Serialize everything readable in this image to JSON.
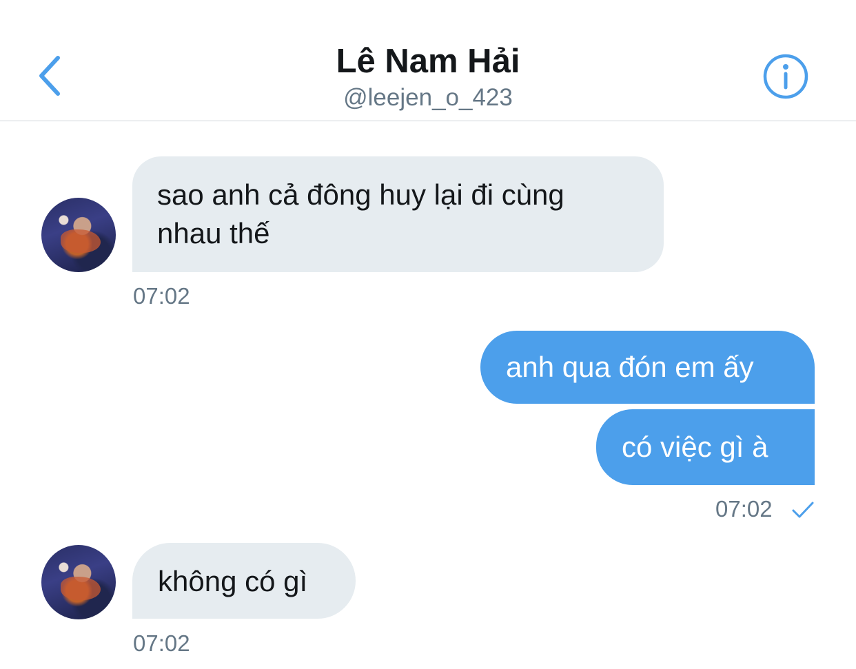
{
  "header": {
    "name": "Lê Nam Hải",
    "handle": "@leejen_o_423",
    "accent_color": "#4c9feb",
    "back_icon": "chevron-left-icon",
    "info_icon": "info-icon"
  },
  "messages": [
    {
      "direction": "incoming",
      "text_line1": "sao anh cả đông huy lại đi cùng",
      "text_line2": "nhau thế",
      "time": "07:02"
    },
    {
      "direction": "outgoing",
      "text": "anh qua đón em ấy"
    },
    {
      "direction": "outgoing",
      "text": "có việc gì à",
      "time": "07:02",
      "status_icon": "check-icon"
    },
    {
      "direction": "incoming",
      "text": "không có gì",
      "time": "07:02"
    }
  ],
  "colors": {
    "incoming_bubble": "#e6ecf0",
    "outgoing_bubble": "#4c9feb",
    "timestamp": "#657786"
  }
}
